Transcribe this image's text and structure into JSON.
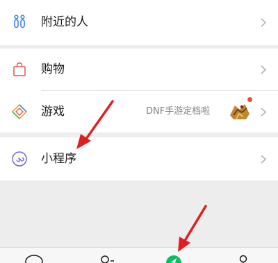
{
  "rows": {
    "people_nearby": "附近的人",
    "shopping": "购物",
    "games": "游戏",
    "games_extra": "DNF手游定档啦",
    "mini_programs": "小程序"
  },
  "icons": {
    "people_nearby": "people-nearby-icon",
    "shopping": "shopping-bag-icon",
    "games": "game-diamond-icon",
    "mini_programs": "mini-program-icon",
    "chevron": "chevron-right-icon",
    "tab_chats": "chat-bubble-icon",
    "tab_contacts": "contacts-icon",
    "tab_discover": "discover-compass-icon",
    "tab_me": "me-person-icon"
  },
  "colors": {
    "accent": "#07c160",
    "annotation_arrow": "#e02020",
    "notification_dot": "#e84c3d"
  }
}
